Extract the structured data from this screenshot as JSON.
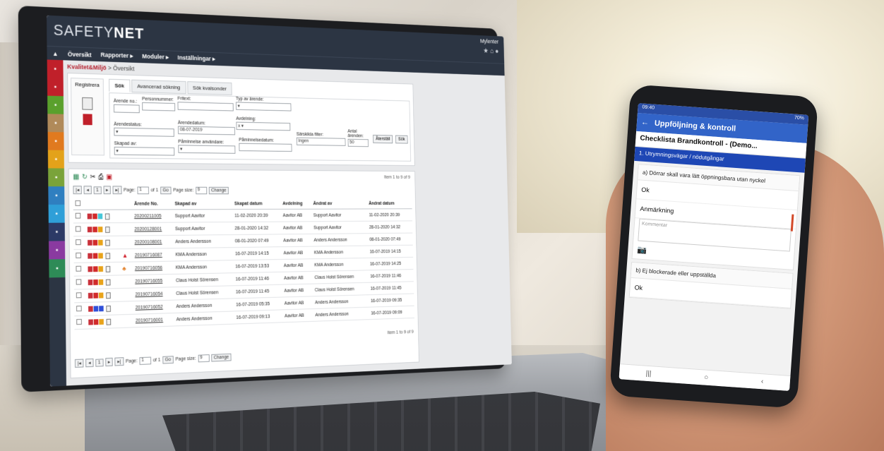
{
  "app": {
    "logo_light": "SAFETY",
    "logo_bold": "NET",
    "user_label": "Mylenter",
    "menu": [
      "Översikt",
      "Rapporter ▸",
      "Moduler ▸",
      "Inställningar ▸"
    ],
    "breadcrumb_module": "Kvalitet&Miljö",
    "breadcrumb_sep": " > ",
    "breadcrumb_page": "Översikt"
  },
  "left_nav": {
    "colors": [
      "#c0202a",
      "#c0202a",
      "#5aa02c",
      "#b08a5a",
      "#e07a1f",
      "#e3a21a",
      "#7aa33a",
      "#2f7fc0",
      "#2f9fd8",
      "#2c3a66",
      "#8a3aa0",
      "#2e8b57"
    ]
  },
  "register": {
    "label": "Registrera"
  },
  "search_panel": {
    "tabs": [
      "Sök",
      "Avancerad sökning",
      "Sök kvalsonder"
    ],
    "fields": {
      "arende_no": "Ärende no.:",
      "personnummer": "Personnummer:",
      "fritext": "Fritext:",
      "typ_av_arende": "Typ av ärende:",
      "avdelning": "Avdelning:",
      "arendestatus": "Ärendestatus:",
      "arendedatum": "Ärendedatum:",
      "arendedatum_value": "08-07-2019",
      "skapad_av": "Skapad av:",
      "paminnelse_anvandare": "Påminnelse användare:",
      "paminnelsedatum": "Påminnelsedatum:",
      "sarskilda_filter": "Särskilda filter:",
      "sarskilda_value": "Ingen",
      "antal_arenden": "Antal ärenden:",
      "antal_value": "50"
    },
    "reset_button": "Återställ",
    "search_button": "Sök"
  },
  "grid": {
    "items_info_top": "Item 1 to 9 of 9",
    "items_info_bottom": "Item 1 to 9 of 9",
    "pager": {
      "page_label": "Page:",
      "page_value": "1",
      "of_label": "of 1",
      "go": "Go",
      "size_label": "Page size:",
      "size_value": "9",
      "change": "Change"
    },
    "columns": [
      "",
      "",
      "",
      "Ärende No.",
      "Skapad av",
      "Skapat datum",
      "Avdelning",
      "Ändrat av",
      "Ändrat datum"
    ],
    "rows": [
      {
        "colors": [
          "#c9303a",
          "#d12a2a",
          "#46c7d8"
        ],
        "icon": "",
        "no": "20200211005",
        "created_by": "Support Aavitor",
        "created": "11-02-2020 20:39",
        "dept": "Aavitor AB",
        "changed_by": "Support Aavitor",
        "changed": "11-02-2020 20:39"
      },
      {
        "colors": [
          "#c9303a",
          "#d12a2a",
          "#e8a31a"
        ],
        "icon": "",
        "no": "20200128001",
        "created_by": "Support Aavitor",
        "created": "28-01-2020 14:32",
        "dept": "Aavitor AB",
        "changed_by": "Support Aavitor",
        "changed": "28-01-2020 14:32"
      },
      {
        "colors": [
          "#c9303a",
          "#d12a2a",
          "#e8a31a"
        ],
        "icon": "",
        "no": "20200108001",
        "created_by": "Anders Andersson",
        "created": "08-01-2020 07:49",
        "dept": "Aavitor AB",
        "changed_by": "Anders Andersson",
        "changed": "08-01-2020 07:49"
      },
      {
        "colors": [
          "#c9303a",
          "#d12a2a",
          "#e8a31a"
        ],
        "icon": "flag",
        "no": "20190716087",
        "created_by": "KMA Andersson",
        "created": "16-07-2019 14:15",
        "dept": "Aavitor AB",
        "changed_by": "KMA Andersson",
        "changed": "16-07-2019 14:15"
      },
      {
        "colors": [
          "#c9303a",
          "#d12a2a",
          "#e8a31a"
        ],
        "icon": "org",
        "no": "20190716056",
        "created_by": "KMA Andersson",
        "created": "16-07-2019 13:53",
        "dept": "Aavitor AB",
        "changed_by": "KMA Andersson",
        "changed": "16-07-2019 14:25"
      },
      {
        "colors": [
          "#c9303a",
          "#d12a2a",
          "#e8a31a"
        ],
        "icon": "",
        "no": "20190716055",
        "created_by": "Claus Holst Sörensen",
        "created": "16-07-2019 11:46",
        "dept": "Aavitor AB",
        "changed_by": "Claus Holst Sörensen",
        "changed": "16-07-2019 11:46"
      },
      {
        "colors": [
          "#c9303a",
          "#d12a2a",
          "#e8a31a"
        ],
        "icon": "",
        "no": "20190716054",
        "created_by": "Claus Holst Sörensen",
        "created": "16-07-2019 11:45",
        "dept": "Aavitor AB",
        "changed_by": "Claus Holst Sörensen",
        "changed": "16-07-2019 11:45"
      },
      {
        "colors": [
          "#c9303a",
          "#2f4fd8",
          "#2f4fd8"
        ],
        "icon": "",
        "no": "20190716052",
        "created_by": "Anders Andersson",
        "created": "16-07-2019 05:35",
        "dept": "Aavitor AB",
        "changed_by": "Anders Andersson",
        "changed": "16-07-2019 09:35"
      },
      {
        "colors": [
          "#c9303a",
          "#d12a2a",
          "#e8a31a"
        ],
        "icon": "",
        "no": "20190716001",
        "created_by": "Anders Andersson",
        "created": "16-07-2019 09:13",
        "dept": "Aavitor AB",
        "changed_by": "Anders Andersson",
        "changed": "16-07-2019 09:09"
      }
    ]
  },
  "phone": {
    "status_left": "09:40",
    "status_right": "70%",
    "appbar_title": "Uppföljning & kontroll",
    "checklist_title": "Checklista Brandkontroll - (Demo...",
    "section": "1. Utrymningsvägar / nödutgångar",
    "question_a": "a) Dörrar skall vara lätt öppningsbara utan nyckel",
    "option_ok": "Ok",
    "option_anm": "Anmärkning",
    "comment_placeholder": "Kommentar",
    "question_b": "b) Ej blockerade eller uppställda",
    "option_ok_b": "Ok"
  }
}
